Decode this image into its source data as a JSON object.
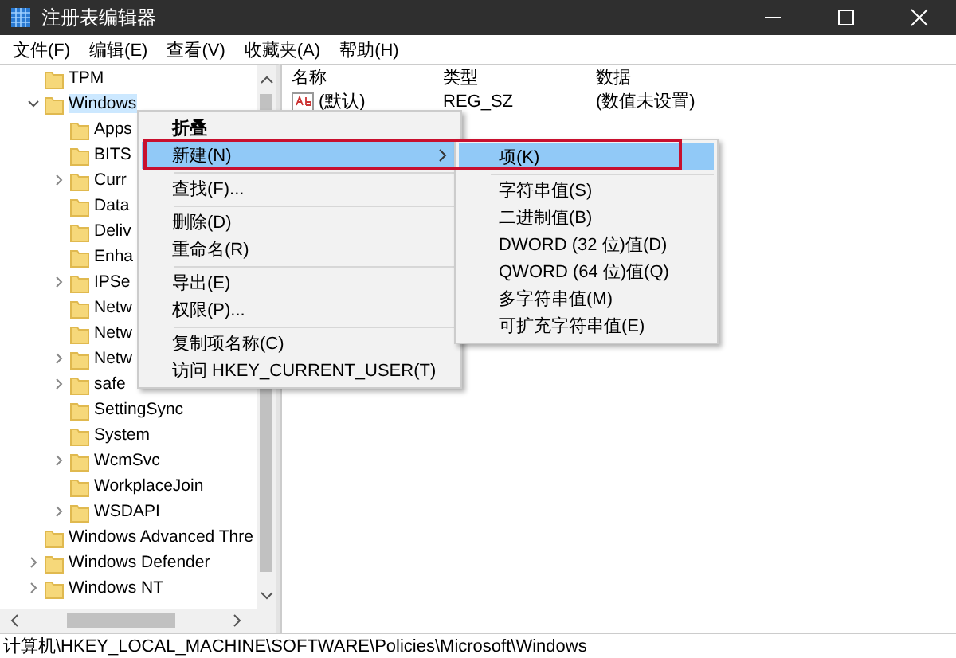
{
  "window": {
    "title": "注册表编辑器"
  },
  "menu_bar": [
    "文件(F)",
    "编辑(E)",
    "查看(V)",
    "收藏夹(A)",
    "帮助(H)"
  ],
  "tree": {
    "items": [
      {
        "label": "TPM",
        "expandable": false,
        "expanded": false,
        "selected": false
      },
      {
        "label": "Windows",
        "expandable": true,
        "expanded": true,
        "selected": true,
        "children": [
          {
            "label": "Apps",
            "expandable": false,
            "expanded": false,
            "selected": false
          },
          {
            "label": "BITS",
            "expandable": false,
            "expanded": false,
            "selected": false
          },
          {
            "label": "Curr",
            "expandable": true,
            "expanded": false,
            "selected": false
          },
          {
            "label": "Data",
            "expandable": false,
            "expanded": false,
            "selected": false
          },
          {
            "label": "Deliv",
            "expandable": false,
            "expanded": false,
            "selected": false
          },
          {
            "label": "Enha",
            "expandable": false,
            "expanded": false,
            "selected": false
          },
          {
            "label": "IPSe",
            "expandable": true,
            "expanded": false,
            "selected": false
          },
          {
            "label": "Netw",
            "expandable": false,
            "expanded": false,
            "selected": false
          },
          {
            "label": "Netw",
            "expandable": false,
            "expanded": false,
            "selected": false
          },
          {
            "label": "Netw",
            "expandable": true,
            "expanded": false,
            "selected": false
          },
          {
            "label": "safe",
            "expandable": true,
            "expanded": false,
            "selected": false
          },
          {
            "label": "SettingSync",
            "expandable": false,
            "expanded": false,
            "selected": false
          },
          {
            "label": "System",
            "expandable": false,
            "expanded": false,
            "selected": false
          },
          {
            "label": "WcmSvc",
            "expandable": true,
            "expanded": false,
            "selected": false
          },
          {
            "label": "WorkplaceJoin",
            "expandable": false,
            "expanded": false,
            "selected": false
          },
          {
            "label": "WSDAPI",
            "expandable": true,
            "expanded": false,
            "selected": false
          }
        ]
      },
      {
        "label": "Windows Advanced Thre",
        "expandable": false,
        "expanded": false,
        "selected": false
      },
      {
        "label": "Windows Defender",
        "expandable": true,
        "expanded": false,
        "selected": false
      },
      {
        "label": "Windows NT",
        "expandable": true,
        "expanded": false,
        "selected": false
      }
    ]
  },
  "list": {
    "columns": [
      "名称",
      "类型",
      "数据"
    ],
    "rows": [
      {
        "name": "(默认)",
        "type": "REG_SZ",
        "data": "(数值未设置)"
      }
    ]
  },
  "context_menu": {
    "items": [
      {
        "kind": "item",
        "label": "折叠",
        "bold": true,
        "submenu": false,
        "selected": false
      },
      {
        "kind": "item",
        "label": "新建(N)",
        "bold": false,
        "submenu": true,
        "selected": true
      },
      {
        "kind": "separator"
      },
      {
        "kind": "item",
        "label": "查找(F)...",
        "bold": false,
        "submenu": false,
        "selected": false
      },
      {
        "kind": "separator"
      },
      {
        "kind": "item",
        "label": "删除(D)",
        "bold": false,
        "submenu": false,
        "selected": false
      },
      {
        "kind": "item",
        "label": "重命名(R)",
        "bold": false,
        "submenu": false,
        "selected": false
      },
      {
        "kind": "separator"
      },
      {
        "kind": "item",
        "label": "导出(E)",
        "bold": false,
        "submenu": false,
        "selected": false
      },
      {
        "kind": "item",
        "label": "权限(P)...",
        "bold": false,
        "submenu": false,
        "selected": false
      },
      {
        "kind": "separator"
      },
      {
        "kind": "item",
        "label": "复制项名称(C)",
        "bold": false,
        "submenu": false,
        "selected": false
      },
      {
        "kind": "item",
        "label": "访问 HKEY_CURRENT_USER(T)",
        "bold": false,
        "submenu": false,
        "selected": false
      }
    ]
  },
  "submenu": {
    "items": [
      {
        "kind": "item",
        "label": "项(K)",
        "bold": false,
        "submenu": false,
        "selected": true
      },
      {
        "kind": "separator"
      },
      {
        "kind": "item",
        "label": "字符串值(S)",
        "bold": false,
        "submenu": false,
        "selected": false
      },
      {
        "kind": "item",
        "label": "二进制值(B)",
        "bold": false,
        "submenu": false,
        "selected": false
      },
      {
        "kind": "item",
        "label": "DWORD (32 位)值(D)",
        "bold": false,
        "submenu": false,
        "selected": false
      },
      {
        "kind": "item",
        "label": "QWORD (64 位)值(Q)",
        "bold": false,
        "submenu": false,
        "selected": false
      },
      {
        "kind": "item",
        "label": "多字符串值(M)",
        "bold": false,
        "submenu": false,
        "selected": false
      },
      {
        "kind": "item",
        "label": "可扩充字符串值(E)",
        "bold": false,
        "submenu": false,
        "selected": false
      }
    ]
  },
  "status_bar": {
    "path": "计算机\\HKEY_LOCAL_MACHINE\\SOFTWARE\\Policies\\Microsoft\\Windows"
  }
}
